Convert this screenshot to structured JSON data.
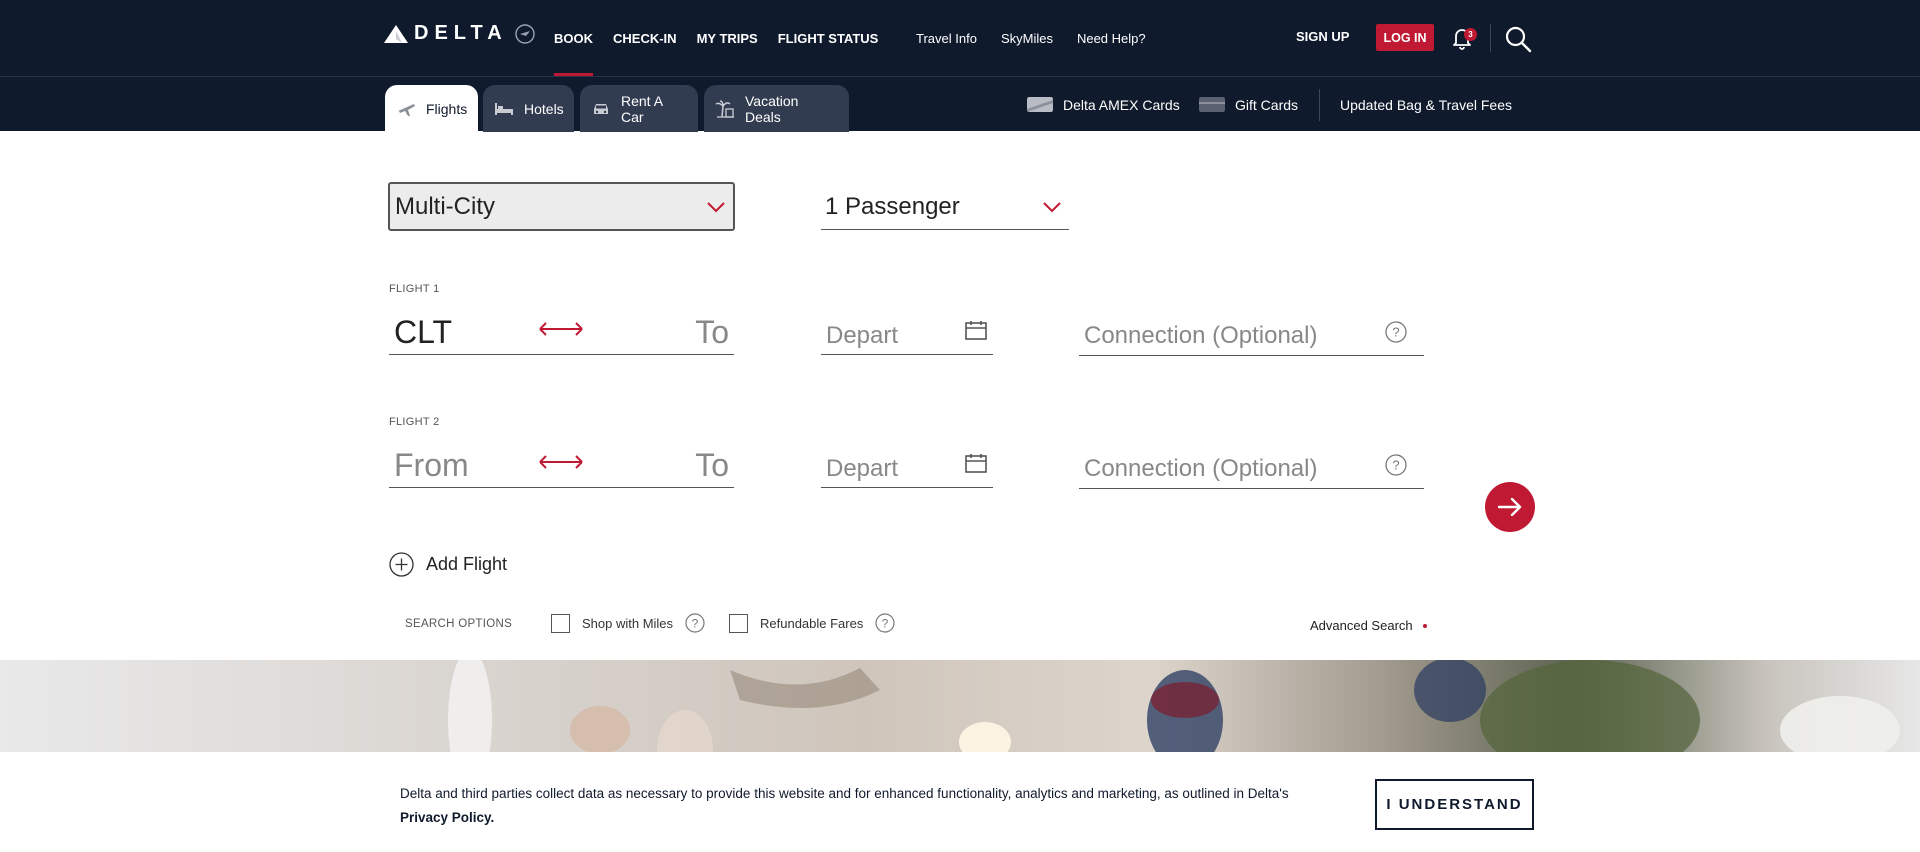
{
  "brand": {
    "logo_text": "DELTA"
  },
  "primary_nav": [
    {
      "label": "BOOK",
      "active": true
    },
    {
      "label": "CHECK-IN"
    },
    {
      "label": "MY TRIPS"
    },
    {
      "label": "FLIGHT STATUS"
    }
  ],
  "secondary_nav": [
    {
      "label": "Travel Info"
    },
    {
      "label": "SkyMiles"
    },
    {
      "label": "Need Help?"
    }
  ],
  "account": {
    "signup_label": "SIGN UP",
    "login_label": "LOG IN",
    "notification_count": "3"
  },
  "tabs": [
    {
      "label": "Flights",
      "icon": "airplane-icon",
      "active": true
    },
    {
      "label": "Hotels",
      "icon": "bed-icon"
    },
    {
      "label": "Rent A Car",
      "icon": "car-icon"
    },
    {
      "label": "Vacation Deals",
      "icon": "palm-tree-icon"
    }
  ],
  "promos": [
    {
      "label": "Delta AMEX Cards",
      "icon": "credit-card-icon"
    },
    {
      "label": "Gift Cards",
      "icon": "gift-card-icon"
    },
    {
      "label": "Updated Bag & Travel Fees"
    }
  ],
  "booking": {
    "trip_type": "Multi-City",
    "passengers": "1 Passenger",
    "flights": [
      {
        "label": "FLIGHT 1",
        "from": "CLT",
        "to_placeholder": "To",
        "depart_placeholder": "Depart",
        "connection_placeholder": "Connection (Optional)"
      },
      {
        "label": "FLIGHT 2",
        "from_placeholder": "From",
        "to_placeholder": "To",
        "depart_placeholder": "Depart",
        "connection_placeholder": "Connection (Optional)"
      }
    ],
    "add_flight_label": "Add Flight",
    "search_options_label": "SEARCH OPTIONS",
    "shop_with_miles_label": "Shop with Miles",
    "refundable_fares_label": "Refundable Fares",
    "advanced_search_label": "Advanced Search"
  },
  "cookie_banner": {
    "message": "Delta and third parties collect data as necessary to provide this website and for enhanced functionality, analytics and marketing, as outlined in Delta's",
    "link_label": "Privacy Policy.",
    "button_label": "I UNDERSTAND"
  },
  "colors": {
    "navy": "#0f1a2d",
    "red": "#c01933",
    "tab_bg": "#323c50"
  }
}
